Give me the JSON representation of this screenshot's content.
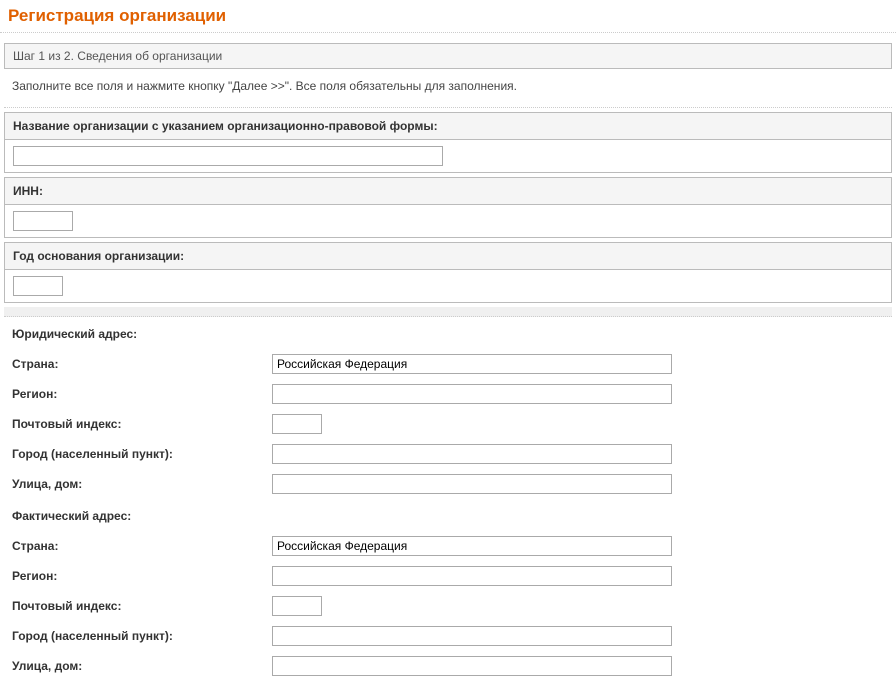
{
  "title": "Регистрация организации",
  "step_text": "Шаг 1 из 2. Сведения об организации",
  "instruction": "Заполните все поля и нажмите кнопку \"Далее >>\". Все поля обязательны для заполнения.",
  "org_name_label": "Название организации с указанием организационно-правовой формы:",
  "inn_label": "ИНН:",
  "year_label": "Год основания организации:",
  "legal_address_section": "Юридический адрес:",
  "actual_address_section": "Фактический адрес:",
  "labels": {
    "country": "Страна:",
    "region": "Регион:",
    "zip": "Почтовый индекс:",
    "city": "Город (населенный пункт):",
    "street": "Улица, дом:"
  },
  "values": {
    "org_name": "",
    "inn": "",
    "year": "",
    "legal": {
      "country": "Российская Федерация",
      "region": "",
      "zip": "",
      "city": "",
      "street": ""
    },
    "actual": {
      "country": "Российская Федерация",
      "region": "",
      "zip": "",
      "city": "",
      "street": ""
    }
  }
}
